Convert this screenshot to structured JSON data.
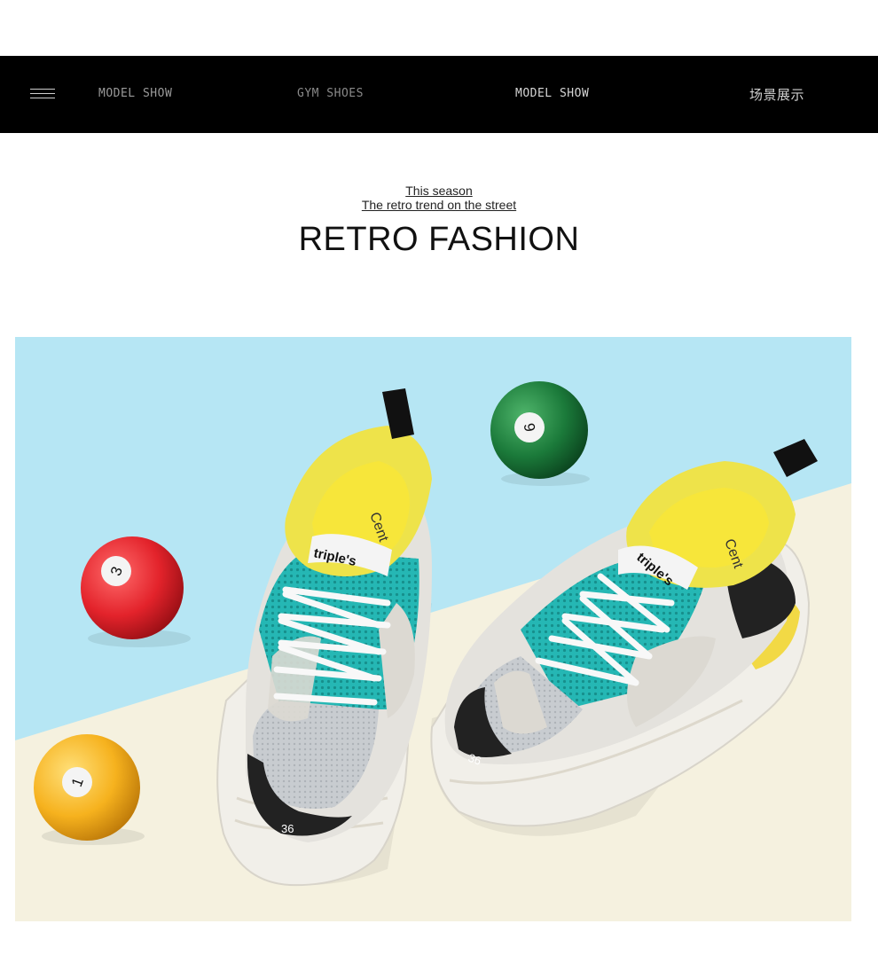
{
  "nav": {
    "items": [
      {
        "label": "MODEL SHOW"
      },
      {
        "label": "GYM SHOES"
      },
      {
        "label": "MODEL SHOW"
      },
      {
        "label": "场景展示"
      }
    ]
  },
  "headline": {
    "line1": "This season",
    "line2": "The retro trend on the street",
    "title": "RETRO FASHION"
  },
  "photo": {
    "shoe_tongue_text": "triple's",
    "insole_text": "Cent",
    "size_left": "36",
    "size_right": "36",
    "ball_numbers": [
      "3",
      "1",
      "6"
    ]
  },
  "colors": {
    "nav_bg": "#000000",
    "photo_bg_blue": "#b6e6f4",
    "photo_bg_cream": "#f5f1df",
    "ball_red": "#e3232b",
    "ball_yellow": "#f6b21e",
    "ball_green": "#1b7a3a",
    "shoe_teal": "#25b7b4",
    "shoe_yellow": "#eee34a"
  }
}
